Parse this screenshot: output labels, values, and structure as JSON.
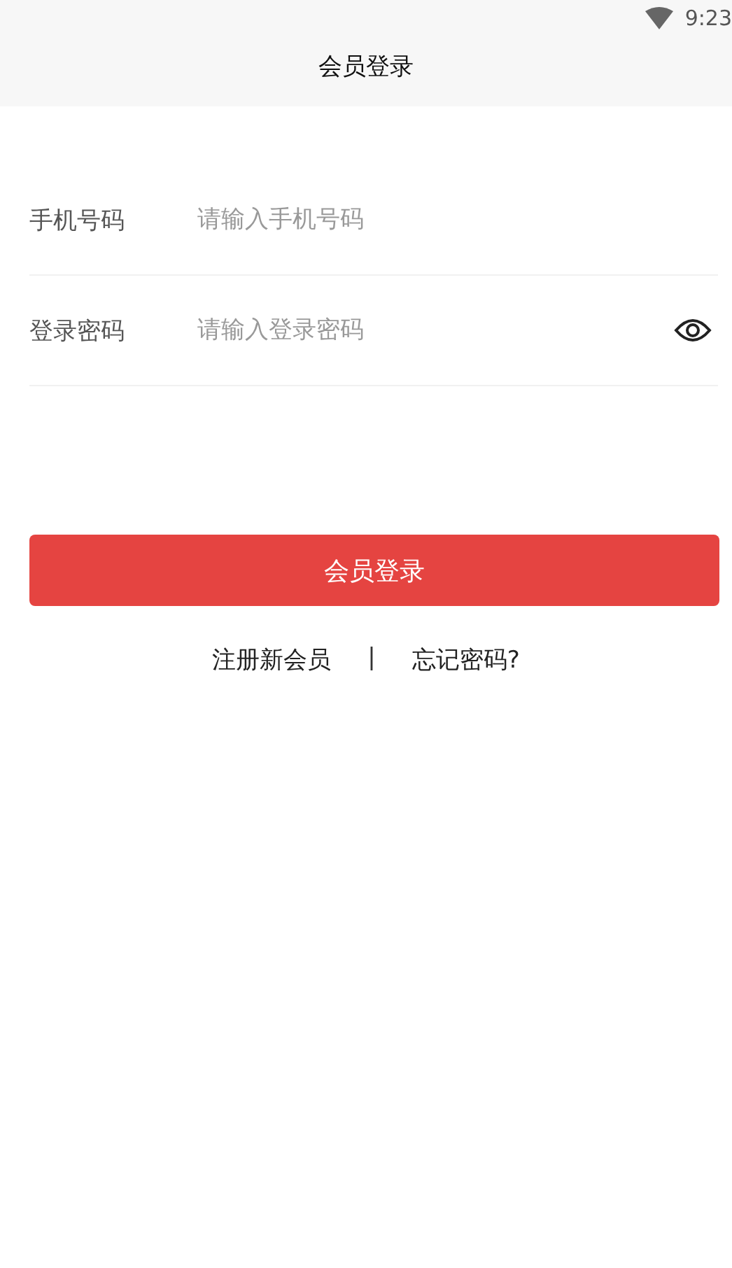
{
  "status_bar": {
    "time": "9:23"
  },
  "header": {
    "title": "会员登录"
  },
  "fields": [
    {
      "kind": "text",
      "label": "手机号码",
      "placeholder": "请输入手机号码"
    },
    {
      "kind": "password",
      "label": "登录密码",
      "placeholder": "请输入登录密码"
    }
  ],
  "login_button": "会员登录",
  "links": [
    "注册新会员",
    "|",
    "忘记密码?"
  ]
}
